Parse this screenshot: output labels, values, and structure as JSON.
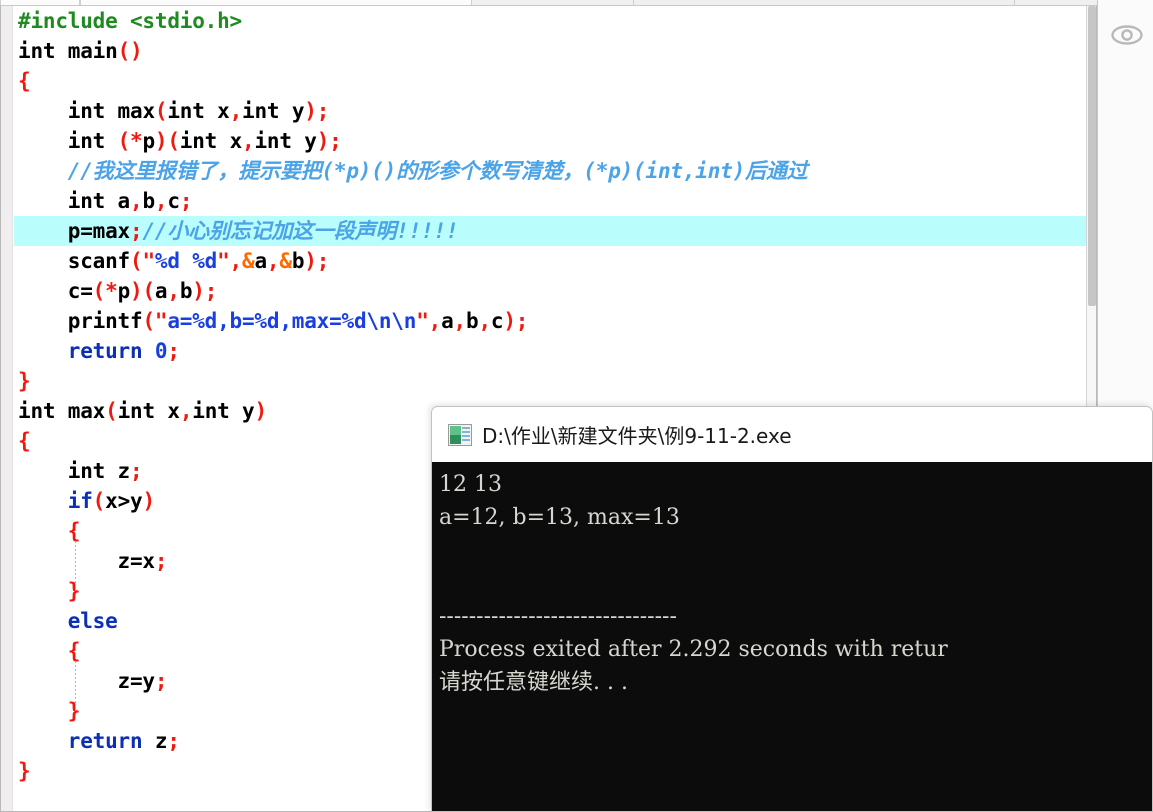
{
  "editor": {
    "name": "code-editor",
    "language": "C",
    "scrollbar": {
      "vertical": true,
      "horizontal": true
    },
    "lines": [
      {
        "indent": 0,
        "highlight": false,
        "tokens": [
          {
            "c": "t-prep",
            "s": "#include <stdio.h>"
          }
        ]
      },
      {
        "indent": 0,
        "highlight": false,
        "tokens": [
          {
            "c": "t-kw",
            "s": "int"
          },
          {
            "c": "t-plain",
            "s": " main"
          },
          {
            "c": "t-punct",
            "s": "()"
          }
        ]
      },
      {
        "indent": 0,
        "highlight": false,
        "tokens": [
          {
            "c": "t-punct",
            "s": "{"
          }
        ]
      },
      {
        "indent": 0,
        "highlight": false,
        "tokens": [
          {
            "c": "t-kw",
            "s": "    int"
          },
          {
            "c": "t-plain",
            "s": " max"
          },
          {
            "c": "t-punct",
            "s": "("
          },
          {
            "c": "t-kw",
            "s": "int"
          },
          {
            "c": "t-plain",
            "s": " x"
          },
          {
            "c": "t-punct",
            "s": ","
          },
          {
            "c": "t-kw",
            "s": "int"
          },
          {
            "c": "t-plain",
            "s": " y"
          },
          {
            "c": "t-punct",
            "s": ");"
          }
        ]
      },
      {
        "indent": 0,
        "highlight": false,
        "tokens": [
          {
            "c": "t-kw",
            "s": "    int"
          },
          {
            "c": "t-plain",
            "s": " "
          },
          {
            "c": "t-punct",
            "s": "(*"
          },
          {
            "c": "t-plain",
            "s": "p"
          },
          {
            "c": "t-punct",
            "s": ")("
          },
          {
            "c": "t-kw",
            "s": "int"
          },
          {
            "c": "t-plain",
            "s": " x"
          },
          {
            "c": "t-punct",
            "s": ","
          },
          {
            "c": "t-kw",
            "s": "int"
          },
          {
            "c": "t-plain",
            "s": " y"
          },
          {
            "c": "t-punct",
            "s": ");"
          }
        ]
      },
      {
        "indent": 0,
        "highlight": false,
        "tokens": [
          {
            "c": "t-cmt",
            "s": "    //我这里报错了，提示要把(*p)()的形参个数写清楚，(*p)(int,int)后通过"
          }
        ]
      },
      {
        "indent": 0,
        "highlight": false,
        "tokens": [
          {
            "c": "t-kw",
            "s": "    int"
          },
          {
            "c": "t-plain",
            "s": " a"
          },
          {
            "c": "t-punct",
            "s": ","
          },
          {
            "c": "t-plain",
            "s": "b"
          },
          {
            "c": "t-punct",
            "s": ","
          },
          {
            "c": "t-plain",
            "s": "c"
          },
          {
            "c": "t-punct",
            "s": ";"
          }
        ]
      },
      {
        "indent": 0,
        "highlight": true,
        "tokens": [
          {
            "c": "t-plain",
            "s": "    p=max"
          },
          {
            "c": "t-punct",
            "s": ";"
          },
          {
            "c": "t-cmt",
            "s": "//小心别忘记加这一段声明!!!!!"
          }
        ]
      },
      {
        "indent": 0,
        "highlight": false,
        "tokens": [
          {
            "c": "t-plain",
            "s": "    scanf"
          },
          {
            "c": "t-punct",
            "s": "(\""
          },
          {
            "c": "t-str",
            "s": "%d %d"
          },
          {
            "c": "t-punct",
            "s": "\","
          },
          {
            "c": "t-amp",
            "s": "&"
          },
          {
            "c": "t-plain",
            "s": "a"
          },
          {
            "c": "t-punct",
            "s": ","
          },
          {
            "c": "t-amp",
            "s": "&"
          },
          {
            "c": "t-plain",
            "s": "b"
          },
          {
            "c": "t-punct",
            "s": ");"
          }
        ]
      },
      {
        "indent": 0,
        "highlight": false,
        "tokens": [
          {
            "c": "t-plain",
            "s": "    c="
          },
          {
            "c": "t-punct",
            "s": "(*"
          },
          {
            "c": "t-plain",
            "s": "p"
          },
          {
            "c": "t-punct",
            "s": ")("
          },
          {
            "c": "t-plain",
            "s": "a"
          },
          {
            "c": "t-punct",
            "s": ","
          },
          {
            "c": "t-plain",
            "s": "b"
          },
          {
            "c": "t-punct",
            "s": ");"
          }
        ]
      },
      {
        "indent": 0,
        "highlight": false,
        "tokens": [
          {
            "c": "t-plain",
            "s": "    printf"
          },
          {
            "c": "t-punct",
            "s": "(\""
          },
          {
            "c": "t-str",
            "s": "a=%d,b=%d,max=%d\\n\\n"
          },
          {
            "c": "t-punct",
            "s": "\","
          },
          {
            "c": "t-plain",
            "s": "a"
          },
          {
            "c": "t-punct",
            "s": ","
          },
          {
            "c": "t-plain",
            "s": "b"
          },
          {
            "c": "t-punct",
            "s": ","
          },
          {
            "c": "t-plain",
            "s": "c"
          },
          {
            "c": "t-punct",
            "s": ");"
          }
        ]
      },
      {
        "indent": 0,
        "highlight": false,
        "tokens": [
          {
            "c": "t-ret",
            "s": "    return"
          },
          {
            "c": "t-num",
            "s": " 0"
          },
          {
            "c": "t-punct",
            "s": ";"
          }
        ]
      },
      {
        "indent": 0,
        "highlight": false,
        "tokens": [
          {
            "c": "t-punct",
            "s": "}"
          }
        ]
      },
      {
        "indent": 0,
        "highlight": false,
        "tokens": [
          {
            "c": "t-kw",
            "s": "int"
          },
          {
            "c": "t-plain",
            "s": " max"
          },
          {
            "c": "t-punct",
            "s": "("
          },
          {
            "c": "t-kw",
            "s": "int"
          },
          {
            "c": "t-plain",
            "s": " x"
          },
          {
            "c": "t-punct",
            "s": ","
          },
          {
            "c": "t-kw",
            "s": "int"
          },
          {
            "c": "t-plain",
            "s": " y"
          },
          {
            "c": "t-punct",
            "s": ")"
          }
        ]
      },
      {
        "indent": 0,
        "highlight": false,
        "tokens": [
          {
            "c": "t-punct",
            "s": "{"
          }
        ]
      },
      {
        "indent": 0,
        "highlight": false,
        "tokens": [
          {
            "c": "t-kw",
            "s": "    int"
          },
          {
            "c": "t-plain",
            "s": " z"
          },
          {
            "c": "t-punct",
            "s": ";"
          }
        ]
      },
      {
        "indent": 0,
        "highlight": false,
        "tokens": [
          {
            "c": "t-ret",
            "s": "    if"
          },
          {
            "c": "t-punct",
            "s": "("
          },
          {
            "c": "t-plain",
            "s": "x>y"
          },
          {
            "c": "t-punct",
            "s": ")"
          }
        ]
      },
      {
        "indent": 0,
        "highlight": false,
        "tokens": [
          {
            "c": "t-punct",
            "s": "    {"
          }
        ]
      },
      {
        "indent": 0,
        "highlight": false,
        "tokens": [
          {
            "c": "t-plain",
            "s": "        z=x"
          },
          {
            "c": "t-punct",
            "s": ";"
          }
        ]
      },
      {
        "indent": 0,
        "highlight": false,
        "tokens": [
          {
            "c": "t-punct",
            "s": "    }"
          }
        ]
      },
      {
        "indent": 0,
        "highlight": false,
        "tokens": [
          {
            "c": "t-ret",
            "s": "    else"
          }
        ]
      },
      {
        "indent": 0,
        "highlight": false,
        "tokens": [
          {
            "c": "t-punct",
            "s": "    {"
          }
        ]
      },
      {
        "indent": 0,
        "highlight": false,
        "tokens": [
          {
            "c": "t-plain",
            "s": "        z=y"
          },
          {
            "c": "t-punct",
            "s": ";"
          }
        ]
      },
      {
        "indent": 0,
        "highlight": false,
        "tokens": [
          {
            "c": "t-punct",
            "s": "    }"
          }
        ]
      },
      {
        "indent": 0,
        "highlight": false,
        "tokens": [
          {
            "c": "t-ret",
            "s": "    return"
          },
          {
            "c": "t-plain",
            "s": " z"
          },
          {
            "c": "t-punct",
            "s": ";"
          }
        ]
      },
      {
        "indent": 0,
        "highlight": false,
        "tokens": [
          {
            "c": "t-punct",
            "s": "}"
          }
        ]
      }
    ]
  },
  "right_panel": {
    "eye_icon": "eye-icon"
  },
  "console": {
    "title": "D:\\作业\\新建文件夹\\例9-11-2.exe",
    "icon": "console-app-icon",
    "lines": [
      "12 13",
      "a=12, b=13, max=13",
      "",
      "",
      "--------------------------------",
      "Process exited after 2.292 seconds with retur",
      "请按任意键继续. . ."
    ]
  },
  "colors": {
    "preprocessor": "#1f8a1f",
    "punctuation": "#f0190f",
    "string": "#1a3fe0",
    "comment": "#4ba3e8",
    "keyword_return": "#0b2fb5",
    "highlight_line": "#b9fdfd",
    "console_bg": "#0c0c0c",
    "console_fg": "#d7d7d0"
  }
}
